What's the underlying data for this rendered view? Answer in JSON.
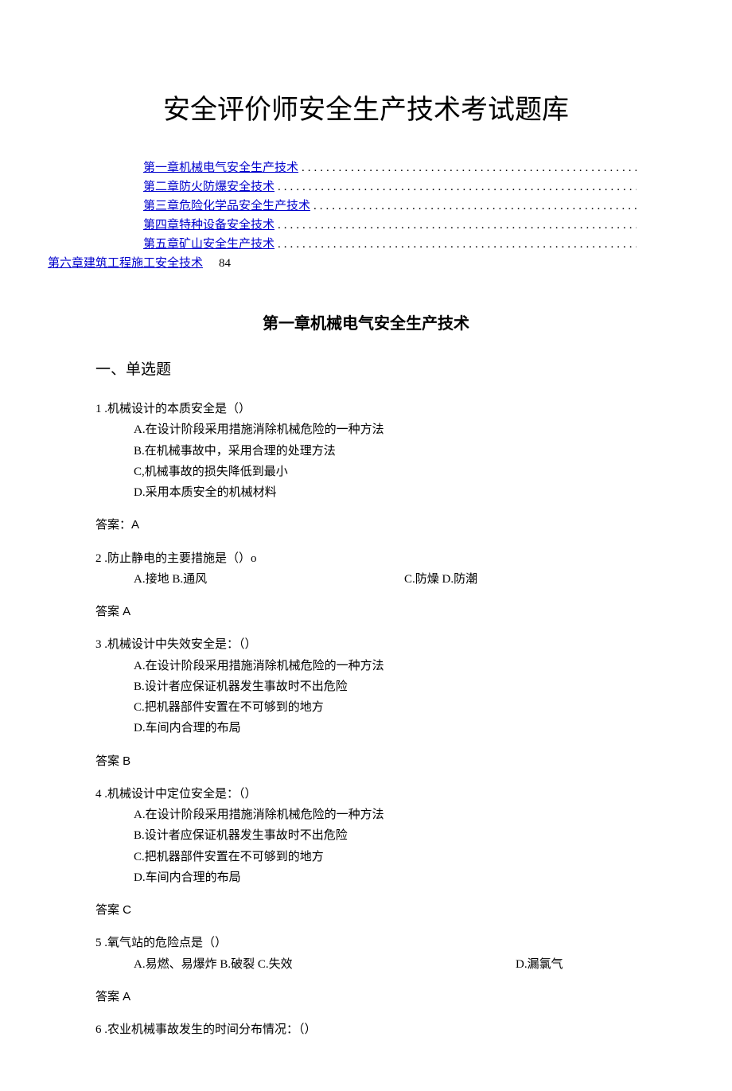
{
  "title": "安全评价师安全生产技术考试题库",
  "toc": [
    {
      "label": "第一章机械电气安全生产技术",
      "indent": true
    },
    {
      "label": "第二章防火防爆安全技术",
      "indent": true
    },
    {
      "label": "第三章危险化学品安全生产技术",
      "indent": true
    },
    {
      "label": "第四章特种设备安全技术",
      "indent": true
    },
    {
      "label": "第五章矿山安全生产技术",
      "indent": true
    },
    {
      "label": "第六章建筑工程施工安全技术",
      "indent": false,
      "page": "84"
    }
  ],
  "chapter_heading": "第一章机械电气安全生产技术",
  "section_heading": "一、单选题",
  "questions": [
    {
      "num": "1",
      "stem": " .机械设计的本质安全是（）",
      "opts": [
        "A.在设计阶段采用措施消除机械危险的一种方法",
        "B.在机械事故中，采用合理的处理方法",
        "C,机械事故的损失降低到最小",
        "D.采用本质安全的机械材料"
      ],
      "answer": "答案：A"
    },
    {
      "num": "2",
      "stem": " .防止静电的主要措施是（）o",
      "opt_row": {
        "left": "A.接地 B.通风",
        "right": "C.防燥 D.防潮"
      },
      "answer": "答案 A"
    },
    {
      "num": "3",
      "stem": " .机械设计中失效安全是：（）",
      "opts": [
        "A.在设计阶段采用措施消除机械危险的一种方法",
        "B.设计者应保证机器发生事故时不出危险",
        "C.把机器部件安置在不可够到的地方",
        "D.车间内合理的布局"
      ],
      "answer": "答案 B"
    },
    {
      "num": "4",
      "stem": " .机械设计中定位安全是：（）",
      "opts": [
        "A.在设计阶段采用措施消除机械危险的一种方法",
        "B.设计者应保证机器发生事故时不出危险",
        "C.把机器部件安置在不可够到的地方",
        "D.车间内合理的布局"
      ],
      "answer": "答案 C"
    },
    {
      "num": "5",
      "stem": " .氧气站的危险点是（）",
      "opt_row": {
        "left": "A.易燃、易爆炸 B.破裂 C.失效",
        "right": "D.漏氯气"
      },
      "answer": "答案 A"
    },
    {
      "num": "6",
      "stem": " .农业机械事故发生的时间分布情况：（）"
    }
  ],
  "dots": "................................................................................................."
}
